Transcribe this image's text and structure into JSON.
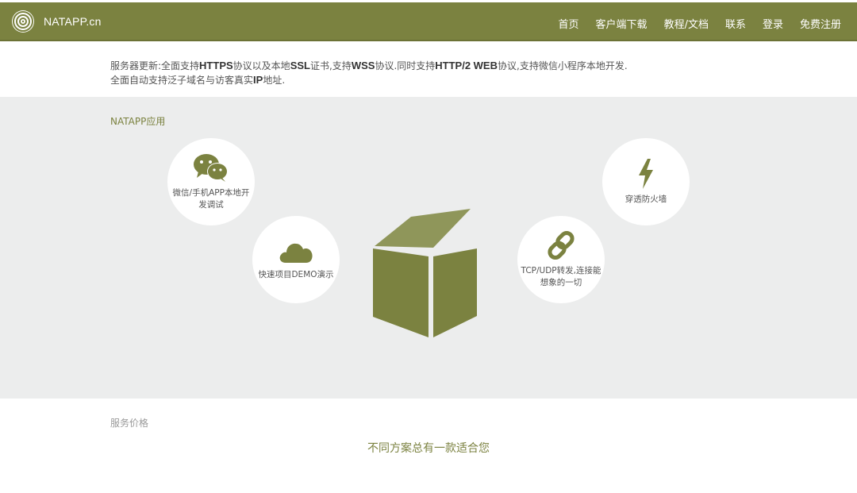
{
  "nav": {
    "brand": "NATAPP.cn",
    "links": [
      "首页",
      "客户端下载",
      "教程/文档",
      "联系",
      "登录",
      "免费注册"
    ]
  },
  "notice": {
    "line1_parts": [
      "服务器更新:全面支持",
      "HTTPS",
      "协议以及本地",
      "SSL",
      "证书,支持",
      "WSS",
      "协议.同时支持",
      "HTTP/2 WEB",
      "协议,支持微信小程序本地开发."
    ],
    "line2_parts": [
      "全面自动支持泛子域名与访客真实",
      "IP",
      "地址."
    ]
  },
  "apps_section": {
    "label": "NATAPP应用",
    "items": [
      {
        "caption": "微信/手机APP本地开发调试",
        "icon": "wechat-icon"
      },
      {
        "caption": "快速项目DEMO演示",
        "icon": "cloud-icon"
      },
      {
        "caption": "TCP/UDP转发,连接能想象的一切",
        "icon": "link-icon"
      },
      {
        "caption": "穿透防火墙",
        "icon": "lightning-icon"
      }
    ]
  },
  "pricing": {
    "label": "服务价格",
    "title": "不同方案总有一款适合您"
  },
  "colors": {
    "brand": "#7b8240",
    "section_bg": "#eceded"
  }
}
